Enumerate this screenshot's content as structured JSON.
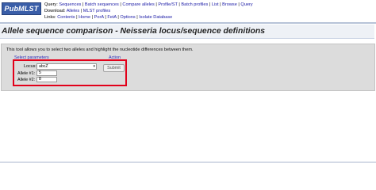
{
  "header": {
    "logo": "PubMLST",
    "query_label": "Query:",
    "query_links": [
      "Sequences",
      "Batch sequences",
      "Compare alleles",
      "Profile/ST",
      "Batch profiles",
      "List",
      "Browse",
      "Query"
    ],
    "download_label": "Download:",
    "download_links": [
      "Alleles",
      "MLST profiles"
    ],
    "links_label": "Links:",
    "links_links": [
      "Contents",
      "Home",
      "PorA",
      "FetA",
      "Options",
      "Isolate Database"
    ]
  },
  "page": {
    "title": "Allele sequence comparison - Neisseria locus/sequence definitions"
  },
  "form": {
    "intro": "This tool allows you to select two alleles and highlight the nucleotide differences between them.",
    "params_legend": "Select parameters",
    "action_legend": "Action",
    "locus_label": "Locus:",
    "locus_value": "abcZ",
    "allele1_label": "Allele #1:",
    "allele1_value": "5",
    "allele2_label": "Allele #2:",
    "allele2_value": "8",
    "submit_label": "Submit"
  },
  "colors": {
    "highlight_box": "#e2001a",
    "link": "#1a1aa6",
    "logo_bg": "#3a5ea8"
  }
}
